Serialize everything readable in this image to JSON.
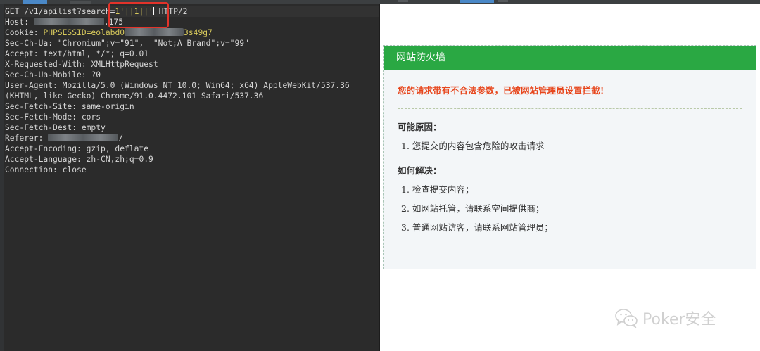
{
  "request": {
    "lines": [
      {
        "before": "GET /v1/apilist?search=",
        "payload": "1'||1||'",
        "after": " HTTP/2"
      },
      {
        "key": "Host: ",
        "masked_before": true,
        "value": ".175"
      },
      {
        "key": "Cookie: ",
        "value": "PHPSESSID=eolabd0",
        "masked_after": true,
        "tail": "3s49g7"
      },
      {
        "key": "Sec-Ch-Ua: ",
        "value": "\"Chromium\";v=\"91\",  \"Not;A Brand\";v=\"99\""
      },
      {
        "key": "Accept: ",
        "value": "text/html, */*; q=0.01"
      },
      {
        "key": "X-Requested-With: ",
        "value": "XMLHttpRequest"
      },
      {
        "key": "Sec-Ch-Ua-Mobile: ",
        "value": "?0"
      },
      {
        "key": "User-Agent: ",
        "value": "Mozilla/5.0 (Windows NT 10.0; Win64; x64) AppleWebKit/537.36"
      },
      {
        "key": "",
        "value": "(KHTML, like Gecko) Chrome/91.0.4472.101 Safari/537.36"
      },
      {
        "key": "Sec-Fetch-Site: ",
        "value": "same-origin"
      },
      {
        "key": "Sec-Fetch-Mode: ",
        "value": "cors"
      },
      {
        "key": "Sec-Fetch-Dest: ",
        "value": "empty"
      },
      {
        "key": "Referer: ",
        "masked_before": true,
        "value": "/"
      },
      {
        "key": "Accept-Encoding: ",
        "value": "gzip, deflate"
      },
      {
        "key": "Accept-Language: ",
        "value": "zh-CN,zh;q=0.9"
      },
      {
        "key": "Connection: ",
        "value": "close"
      }
    ]
  },
  "response": {
    "header_title": "网站防火墙",
    "message": "您的请求带有不合法参数，已被网站管理员设置拦截！",
    "reasons_title": "可能原因：",
    "reasons": [
      "1. 您提交的内容包含危险的攻击请求"
    ],
    "solutions_title": "如何解决：",
    "solutions": [
      "1. 检查提交内容；",
      "2. 如网站托管，请联系空间提供商；",
      "3. 普通网站访客，请联系网站管理员；"
    ]
  },
  "watermark": {
    "text": "Poker安全",
    "icon": "wechat-icon"
  },
  "colors": {
    "editor_bg": "#2b2b2b",
    "highlight_box": "#e2332a",
    "waf_green": "#2aa843",
    "warning_red": "#e7461c"
  }
}
